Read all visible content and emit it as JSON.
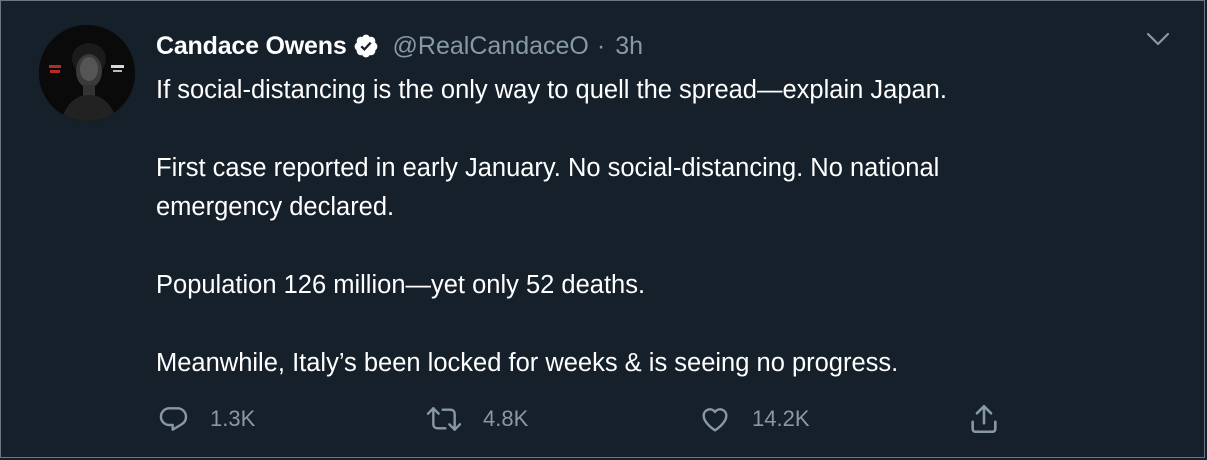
{
  "tweet": {
    "display_name": "Candace Owens",
    "verified": true,
    "handle": "@RealCandaceO",
    "separator": "·",
    "time": "3h",
    "lines": [
      "If social-distancing is the only way to quell the spread—explain Japan.",
      "",
      "First case reported in early January. No social-distancing. No national",
      "emergency declared.",
      "",
      "Population 126 million—yet only 52 deaths.",
      "",
      "Meanwhile, Italy’s been locked for weeks & is seeing no progress."
    ]
  },
  "actions": {
    "reply_count": "1.3K",
    "retweet_count": "4.8K",
    "like_count": "14.2K"
  },
  "colors": {
    "background": "#15202b",
    "text": "#ffffff",
    "secondary": "#8899a6",
    "verified_badge": "#ffffff"
  },
  "icons": {
    "reply": "reply-icon",
    "retweet": "retweet-icon",
    "like": "like-icon",
    "share": "share-icon",
    "caret": "chevron-down-icon",
    "verified": "verified-badge-icon"
  }
}
